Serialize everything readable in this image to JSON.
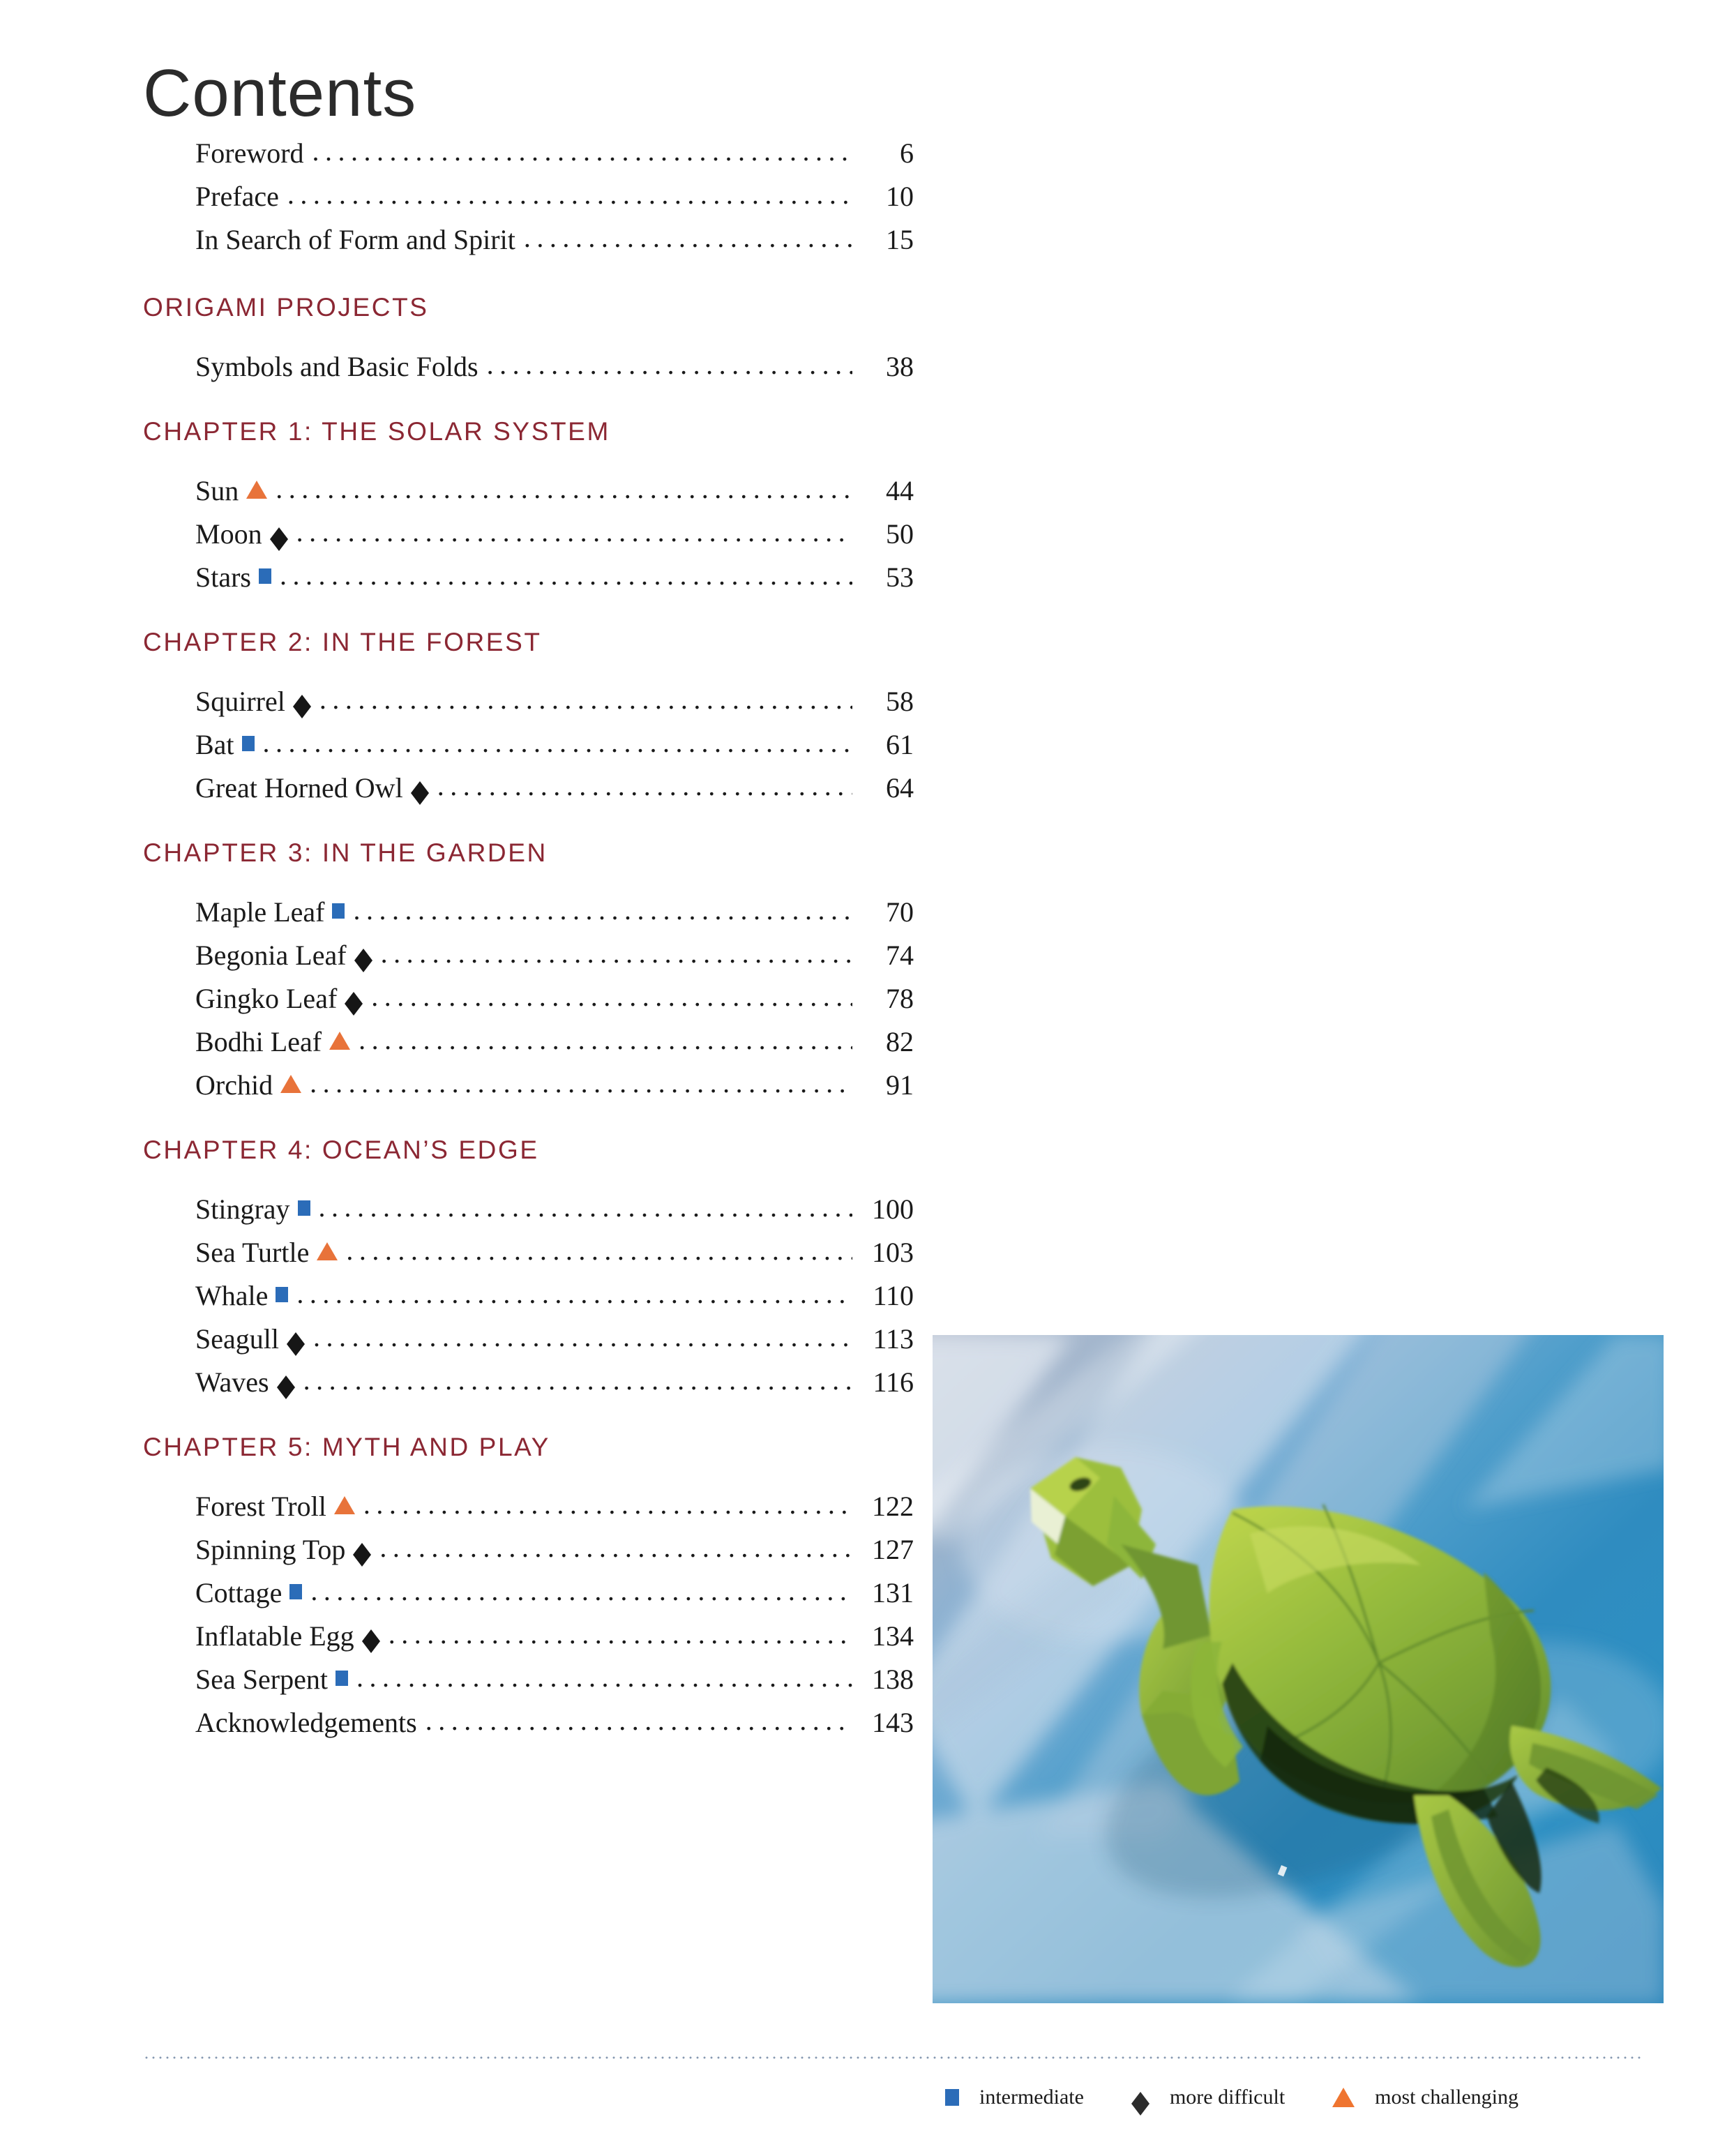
{
  "page": {
    "title": "Contents",
    "colors": {
      "heading_maroon": "#8b2733",
      "intermediate_blue": "#2b6cb8",
      "more_difficult_black": "#161616",
      "most_challenging_orange": "#e8733a",
      "rule_blue": "#7f93ad",
      "body_text": "#1a1a1a"
    }
  },
  "front_matter": [
    {
      "title": "Foreword",
      "mark": "none",
      "page": "6"
    },
    {
      "title": "Preface",
      "mark": "none",
      "page": "10"
    },
    {
      "title": "In Search of Form and Spirit",
      "mark": "none",
      "page": "15"
    }
  ],
  "sections": [
    {
      "heading": "ORIGAMI PROJECTS",
      "entries": [
        {
          "title": "Symbols and Basic Folds",
          "mark": "none",
          "page": "38"
        }
      ]
    },
    {
      "heading": "CHAPTER 1: THE SOLAR SYSTEM",
      "entries": [
        {
          "title": "Sun",
          "mark": "triangle",
          "page": "44"
        },
        {
          "title": "Moon",
          "mark": "diamond",
          "page": "50"
        },
        {
          "title": "Stars",
          "mark": "square",
          "page": "53"
        }
      ]
    },
    {
      "heading": "CHAPTER 2: IN THE FOREST",
      "entries": [
        {
          "title": "Squirrel",
          "mark": "diamond",
          "page": "58"
        },
        {
          "title": "Bat",
          "mark": "square",
          "page": "61"
        },
        {
          "title": "Great Horned Owl",
          "mark": "diamond",
          "page": "64"
        }
      ]
    },
    {
      "heading": "CHAPTER 3: IN THE GARDEN",
      "entries": [
        {
          "title": "Maple Leaf",
          "mark": "square",
          "page": "70"
        },
        {
          "title": "Begonia Leaf",
          "mark": "diamond",
          "page": "74"
        },
        {
          "title": "Gingko Leaf",
          "mark": "diamond",
          "page": "78"
        },
        {
          "title": "Bodhi Leaf",
          "mark": "triangle",
          "page": "82"
        },
        {
          "title": "Orchid",
          "mark": "triangle",
          "page": "91"
        }
      ]
    },
    {
      "heading": "CHAPTER 4: OCEAN’S EDGE",
      "entries": [
        {
          "title": "Stingray",
          "mark": "square",
          "page": "100"
        },
        {
          "title": "Sea Turtle",
          "mark": "triangle",
          "page": "103"
        },
        {
          "title": "Whale",
          "mark": "square",
          "page": "110"
        },
        {
          "title": "Seagull",
          "mark": "diamond",
          "page": "113"
        },
        {
          "title": "Waves",
          "mark": "diamond",
          "page": "116"
        }
      ]
    },
    {
      "heading": "CHAPTER 5: MYTH AND PLAY",
      "entries": [
        {
          "title": "Forest Troll",
          "mark": "triangle",
          "page": "122"
        },
        {
          "title": "Spinning Top",
          "mark": "diamond",
          "page": "127"
        },
        {
          "title": "Cottage",
          "mark": "square",
          "page": "131"
        },
        {
          "title": "Inflatable Egg",
          "mark": "diamond",
          "page": "134"
        },
        {
          "title": "Sea Serpent",
          "mark": "square",
          "page": "138"
        },
        {
          "title": "Acknowledgements",
          "mark": "none",
          "page": "143"
        }
      ]
    }
  ],
  "photo": {
    "subject": "origami-sea-turtle",
    "description": "Green origami sea turtle swimming against a blue and white watery background"
  },
  "legend": [
    {
      "symbol": "square",
      "label": "intermediate"
    },
    {
      "symbol": "diamond",
      "label": "more difficult"
    },
    {
      "symbol": "triangle",
      "label": "most challenging"
    }
  ]
}
